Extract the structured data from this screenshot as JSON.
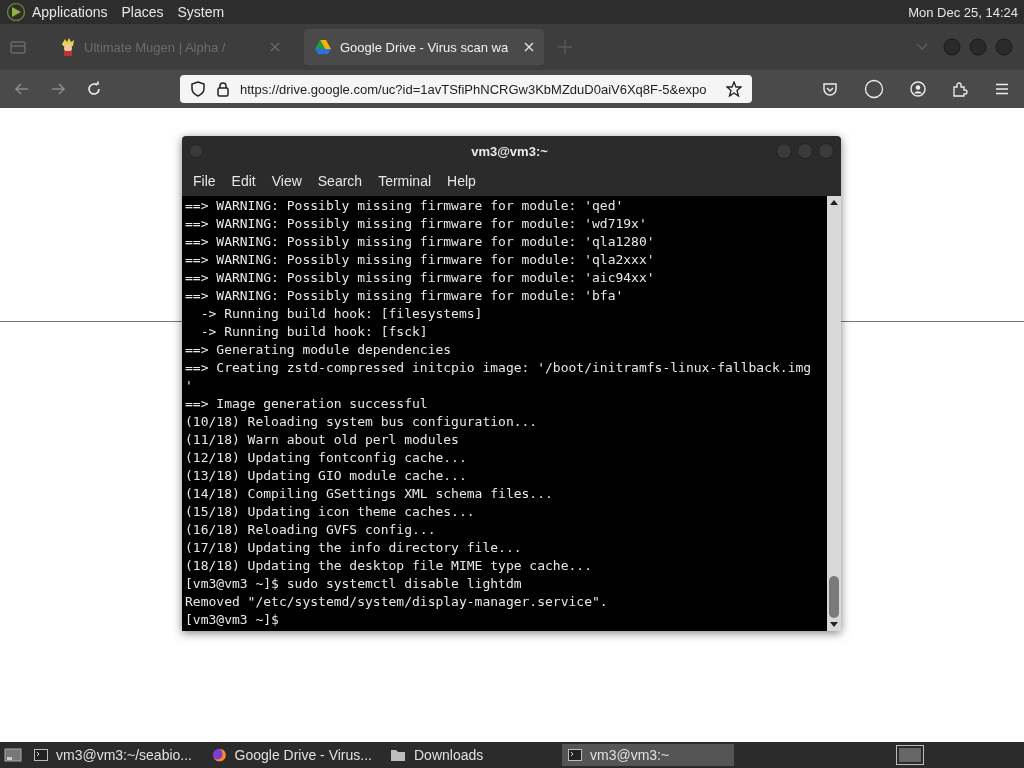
{
  "top_panel": {
    "menus": [
      "Applications",
      "Places",
      "System"
    ],
    "clock": "Mon Dec 25, 14:24"
  },
  "browser": {
    "tabs": [
      {
        "title": "Ultimate Mugen | Alpha /",
        "selected": false,
        "kind": "character"
      },
      {
        "title": "Google Drive - Virus scan wa",
        "selected": true,
        "kind": "drive"
      }
    ],
    "url": "https://drive.google.com/uc?id=1avTSfiPhNCRGw3KbMZduD0aiV6Xq8F-5&expo"
  },
  "terminal": {
    "title": "vm3@vm3:~",
    "menus": [
      "File",
      "Edit",
      "View",
      "Search",
      "Terminal",
      "Help"
    ],
    "lines": [
      "==> WARNING: Possibly missing firmware for module: 'qed'",
      "==> WARNING: Possibly missing firmware for module: 'wd719x'",
      "==> WARNING: Possibly missing firmware for module: 'qla1280'",
      "==> WARNING: Possibly missing firmware for module: 'qla2xxx'",
      "==> WARNING: Possibly missing firmware for module: 'aic94xx'",
      "==> WARNING: Possibly missing firmware for module: 'bfa'",
      "  -> Running build hook: [filesystems]",
      "  -> Running build hook: [fsck]",
      "==> Generating module dependencies",
      "==> Creating zstd-compressed initcpio image: '/boot/initramfs-linux-fallback.img",
      "'",
      "==> Image generation successful",
      "(10/18) Reloading system bus configuration...",
      "(11/18) Warn about old perl modules",
      "(12/18) Updating fontconfig cache...",
      "(13/18) Updating GIO module cache...",
      "(14/18) Compiling GSettings XML schema files...",
      "(15/18) Updating icon theme caches...",
      "(16/18) Reloading GVFS config...",
      "(17/18) Updating the info directory file...",
      "(18/18) Updating the desktop file MIME type cache...",
      "[vm3@vm3 ~]$ sudo systemctl disable lightdm",
      "Removed \"/etc/systemd/system/display-manager.service\".",
      "[vm3@vm3 ~]$"
    ]
  },
  "taskbar": {
    "items": [
      {
        "label": "vm3@vm3:~/seabio...",
        "kind": "terminal",
        "selected": false
      },
      {
        "label": "Google Drive - Virus...",
        "kind": "browser",
        "selected": false
      },
      {
        "label": "Downloads",
        "kind": "folder",
        "selected": false
      },
      {
        "label": "vm3@vm3:~",
        "kind": "terminal",
        "selected": true
      }
    ]
  }
}
